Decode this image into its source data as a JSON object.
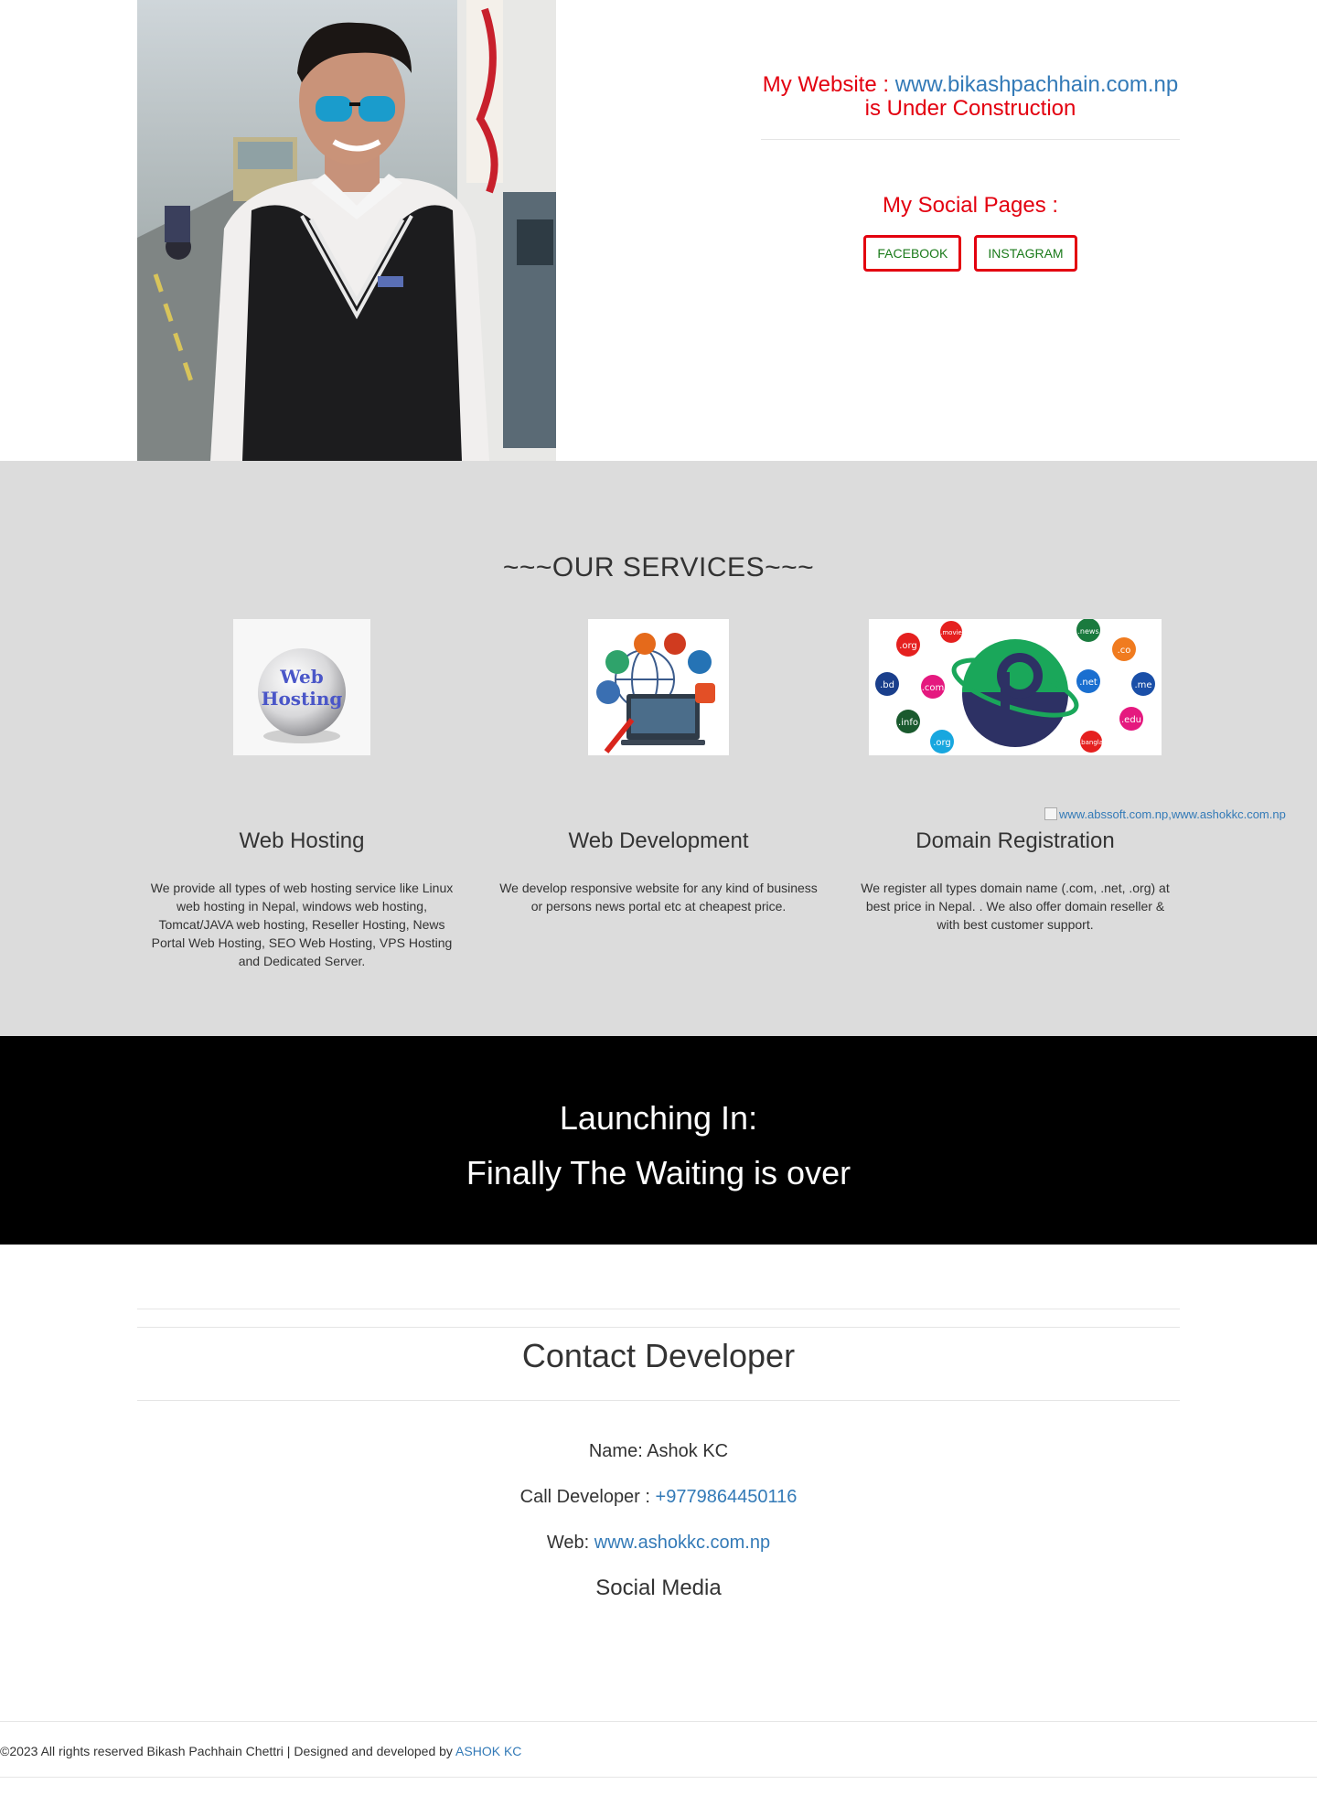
{
  "hero": {
    "photo_alt": "profile photo",
    "site_prefix": "My Website :",
    "site_link": "www.bikashpachhain.com.np",
    "site_suffix": "is Under Construction",
    "social_title": "My Social Pages :",
    "buttons": [
      "FACEBOOK",
      "INSTAGRAM"
    ]
  },
  "services": {
    "title": "~~~OUR SERVICES~~~",
    "items": [
      {
        "name": "Web Hosting",
        "desc": "We provide all types of web hosting service like Linux web hosting in Nepal, windows web hosting, Tomcat/JAVA web hosting, Reseller Hosting, News Portal Web Hosting, SEO Web Hosting, VPS Hosting and Dedicated Server.",
        "img_text_1": "Web",
        "img_text_2": "Hosting"
      },
      {
        "name": "Web Development",
        "desc": "We develop responsive website for any kind of business or persons news portal etc at cheapest price."
      },
      {
        "name": "Domain Registration",
        "desc": "We register all types domain name (.com, .net, .org) at best price in Nepal. . We also offer domain reseller & with best customer support.",
        "tlds": [
          ".org",
          ".movie",
          ".news",
          ".co",
          ".bd",
          ".com",
          ".net",
          ".me",
          ".info",
          ".edu",
          ".org",
          ".bangla"
        ]
      }
    ],
    "broken_image_alt": "www.abssoft.com.np,www.ashokkc.com.np"
  },
  "launch": {
    "heading": "Launching In:",
    "subheading": "Finally The Waiting is over"
  },
  "contact": {
    "title": "Contact Developer",
    "name_line": "Name: Ashok KC",
    "call_label": "Call Developer :",
    "call_number": "+9779864450116",
    "web_label": "Web:",
    "web_link": "www.ashokkc.com.np",
    "social_title": "Social Media"
  },
  "footer": {
    "text": "©2023 All rights reserved Bikash Pachhain Chettri | Designed and developed by",
    "link": "ASHOK KC"
  },
  "colors": {
    "accent_red": "#e3000f",
    "link_blue": "#337ab7",
    "button_text_green": "#1a7a1a",
    "services_bg": "#dcdcdc",
    "launch_bg": "#000000"
  }
}
